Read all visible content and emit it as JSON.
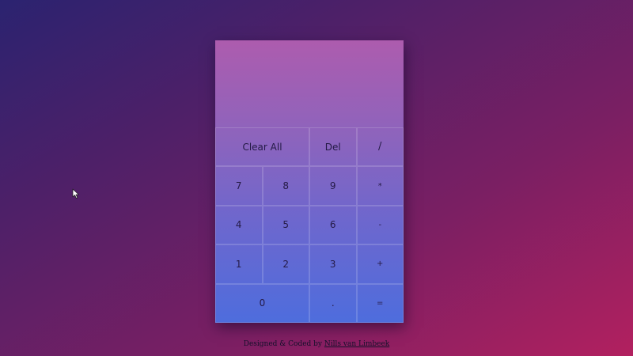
{
  "calculator": {
    "display": "",
    "keys": {
      "clear_all": "Clear All",
      "del": "Del",
      "divide": "/",
      "seven": "7",
      "eight": "8",
      "nine": "9",
      "multiply": "*",
      "four": "4",
      "five": "5",
      "six": "6",
      "minus": "-",
      "one": "1",
      "two": "2",
      "three": "3",
      "plus": "+",
      "zero": "0",
      "decimal": ".",
      "equals": "="
    }
  },
  "footer": {
    "prefix": "Designed & Coded by",
    "author_link": "Nills van Limbeek"
  },
  "colors": {
    "background_start": "#2b2370",
    "background_end": "#b2205f",
    "calculator_top": "#ad5cae",
    "calculator_bottom": "#4e6ddd"
  }
}
